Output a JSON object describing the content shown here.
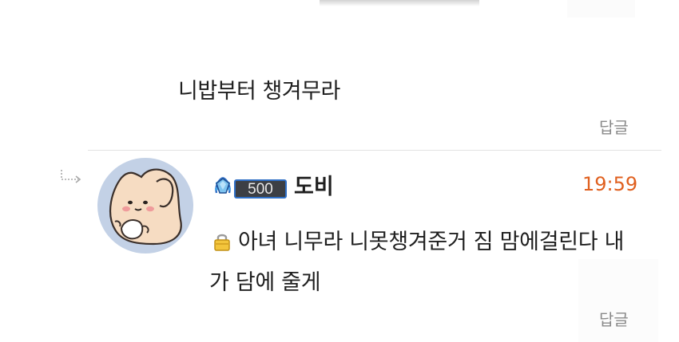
{
  "comments": [
    {
      "text": "니밥부터 챙겨무라",
      "reply_label": "답글"
    }
  ],
  "reply_comment": {
    "nickname": "도비",
    "level_badge": "500",
    "timestamp": "19:59",
    "secret": true,
    "text": "아녀 니무라 니못챙겨준거 짐 맘에걸린다 내가 담에 줄게",
    "reply_label": "답글"
  },
  "colors": {
    "timestamp": "#e0601f",
    "reply_link": "#8a8a8a",
    "avatar_bg": "#c3d1e6",
    "divider": "#e3e3e3"
  },
  "icons": [
    "reply-arrow-icon",
    "level-badge-icon",
    "lock-icon",
    "avatar-character"
  ]
}
